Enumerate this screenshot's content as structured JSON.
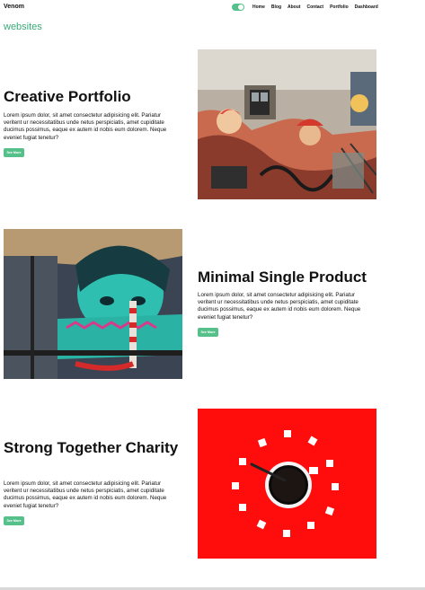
{
  "nav": {
    "brand": "Venom",
    "links": [
      "Home",
      "Blog",
      "About",
      "Contact",
      "Portfolio",
      "Dashboard"
    ]
  },
  "tagline": "websites",
  "sections": [
    {
      "title": "Creative Portfolio",
      "text": "Lorem ipsum dolor, sit amet consectetur adipisicing elit. Pariatur veritent ur necessitatibus unde netus perspiciatis, amet cupiditate ducimus possimus, eaque ex autem id nobis eum dolorem. Neque eveniet fugiat tenetur?",
      "button": "See More"
    },
    {
      "title": "Minimal Single Product",
      "text": "Lorem ipsum dolor, sit amet consectetur adipisicing elit. Pariatur veritent ur necessitatibus unde netus perspiciatis, amet cupiditate ducimus possimus, eaque ex autem id nobis eum dolorem. Neque eveniet fugiat tenetur?",
      "button": "See More"
    },
    {
      "title": "Strong Together Charity",
      "text": "Lorem ipsum dolor, sit amet consectetur adipisicing elit. Pariatur veritent ur necessitatibus unde netus perspiciatis, amet cupiditate ducimus possimus, eaque ex autem id nobis eum dolorem. Neque eveniet fugiat tenetur?",
      "button": "See More"
    }
  ],
  "colors": {
    "accent": "#56c08a",
    "tagline": "#3aa978",
    "coffee_bg": "#ff0d0d"
  }
}
